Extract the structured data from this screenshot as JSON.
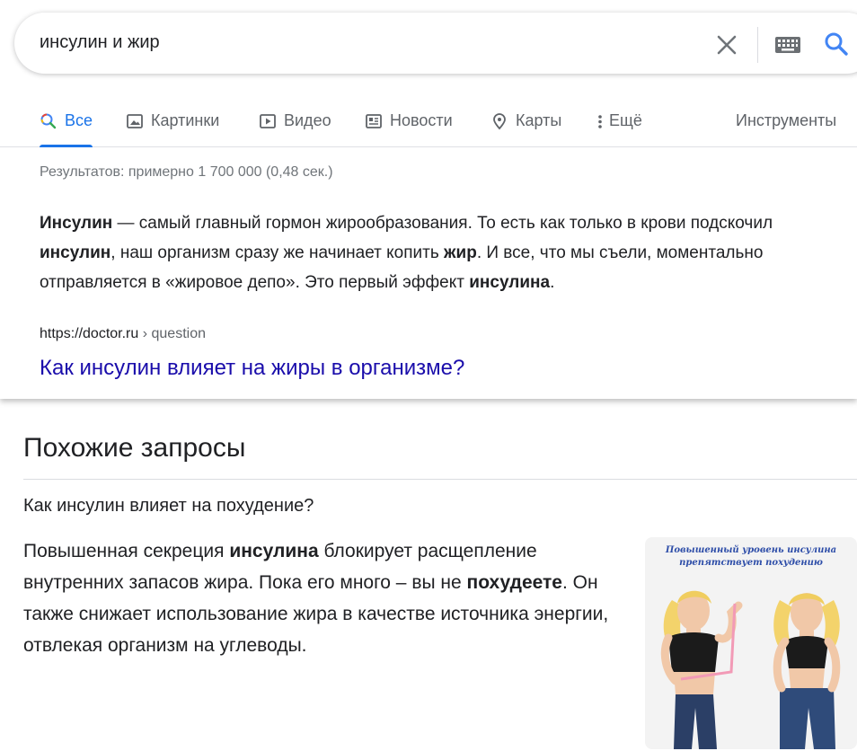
{
  "search": {
    "query": "инсулин и жир"
  },
  "tabs": [
    {
      "label": "Все",
      "icon": "search-icon",
      "active": true
    },
    {
      "label": "Картинки",
      "icon": "image-icon",
      "active": false
    },
    {
      "label": "Видео",
      "icon": "video-icon",
      "active": false
    },
    {
      "label": "Новости",
      "icon": "news-icon",
      "active": false
    },
    {
      "label": "Карты",
      "icon": "map-pin-icon",
      "active": false
    },
    {
      "label": "Ещё",
      "icon": "more-vert-icon",
      "active": false
    }
  ],
  "tools_label": "Инструменты",
  "stats": "Результатов: примерно 1 700 000 (0,48 сек.)",
  "featured": {
    "snippet_html": "<b>Инсулин</b> — самый главный гормон жирообразования. То есть как только в крови подскочил <b>инсулин</b>, наш организм сразу же начинает копить <b>жир</b>. И все, что мы съели, моментально отправляется в «жировое депо». Это первый эффект <b>инсулина</b>.",
    "cite_domain": "https://doctor.ru",
    "cite_path": " › question",
    "title": "Как инсулин влияет на жиры в организме?"
  },
  "related": {
    "heading": "Похожие запросы",
    "question": "Как инсулин влияет на похудение?",
    "answer_html": "Повышенная секреция <b>инсулина</b> блокирует расщепление внутренних запасов жира. Пока его много – вы не <b>похудеете</b>. Он также снижает использование жира в качестве источника энергии, отвлекая организм на углеводы.",
    "image_caption_line1": "Повышенный уровень инсулина",
    "image_caption_line2": "препятствует похудению"
  },
  "colors": {
    "link": "#1a0dab",
    "accent": "#1a73e8",
    "muted": "#70757a"
  }
}
